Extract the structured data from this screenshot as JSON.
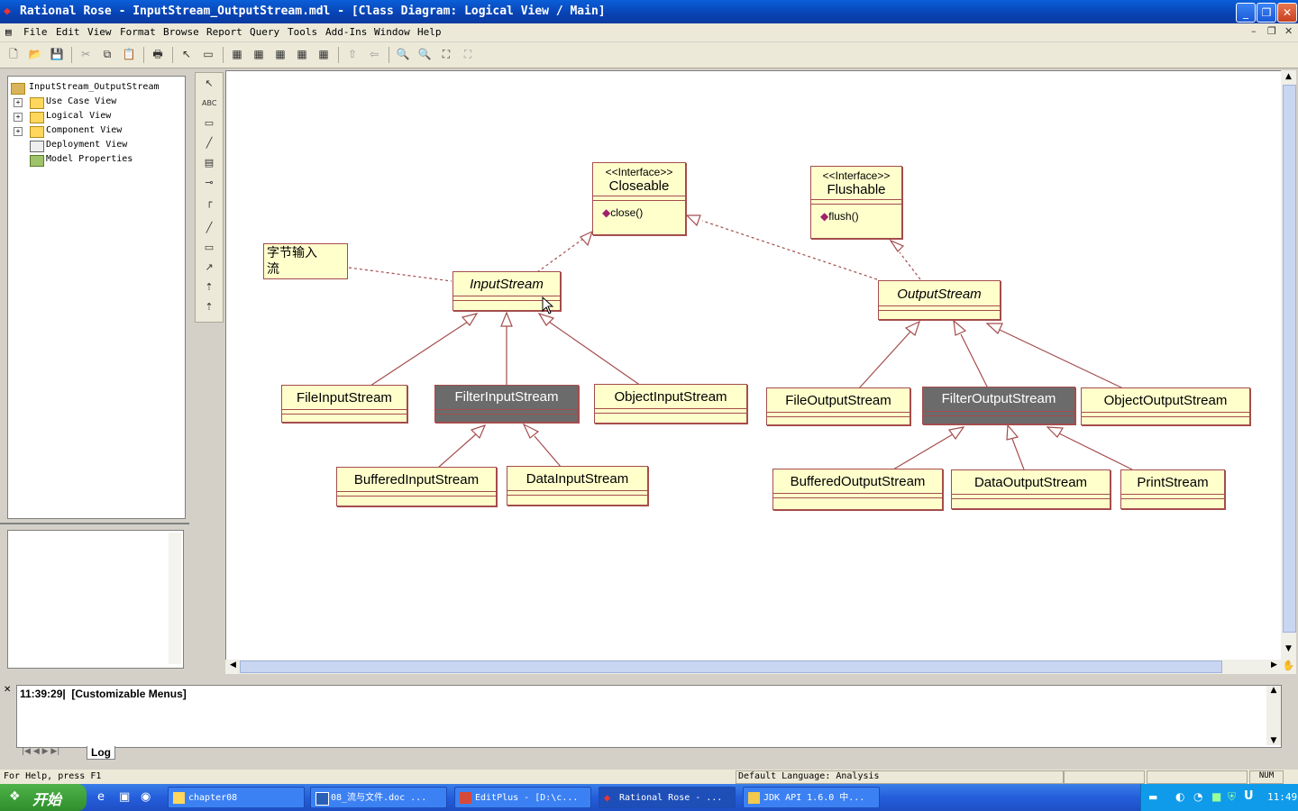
{
  "window": {
    "title": "Rational Rose - InputStream_OutputStream.mdl - [Class Diagram: Logical View / Main]"
  },
  "menu": {
    "items": [
      "File",
      "Edit",
      "View",
      "Format",
      "Browse",
      "Report",
      "Query",
      "Tools",
      "Add-Ins",
      "Window",
      "Help"
    ]
  },
  "tree": {
    "root": "InputStream_OutputStream",
    "items": [
      "Use Case View",
      "Logical View",
      "Component View",
      "Deployment View",
      "Model Properties"
    ]
  },
  "diagram": {
    "closeable": {
      "stereotype": "<<Interface>>",
      "name": "Closeable",
      "op": "close()"
    },
    "flushable": {
      "stereotype": "<<Interface>>",
      "name": "Flushable",
      "op": "flush()"
    },
    "note": {
      "line1": "字节输入",
      "line2": "流"
    },
    "classes": {
      "inputstream": "InputStream",
      "outputstream": "OutputStream",
      "fileinputstream": "FileInputStream",
      "filterinputstream": "FilterInputStream",
      "objectinputstream": "ObjectInputStream",
      "fileoutputstream": "FileOutputStream",
      "filteroutputstream": "FilterOutputStream",
      "objectoutputstream": "ObjectOutputStream",
      "bufferedinputstream": "BufferedInputStream",
      "datainputstream": "DataInputStream",
      "bufferedoutputstream": "BufferedOutputStream",
      "dataoutputstream": "DataOutputStream",
      "printstream": "PrintStream"
    }
  },
  "log": {
    "entry": "11:39:29|  [Customizable Menus]",
    "tab": "Log"
  },
  "status": {
    "help": "For Help, press F1",
    "language": "Default Language: Analysis",
    "num": "NUM"
  },
  "taskbar": {
    "start": "开始",
    "tasks": [
      "chapter08",
      "08_流与文件.doc ...",
      "EditPlus - [D:\\c...",
      "Rational Rose - ...",
      "JDK API 1.6.0 中..."
    ],
    "clock": "11:49"
  },
  "colors": {
    "class_fill": "#ffffcc",
    "class_border": "#a54c4c",
    "selected_fill": "#6b6b6b",
    "title_bar": "#0842b3"
  }
}
